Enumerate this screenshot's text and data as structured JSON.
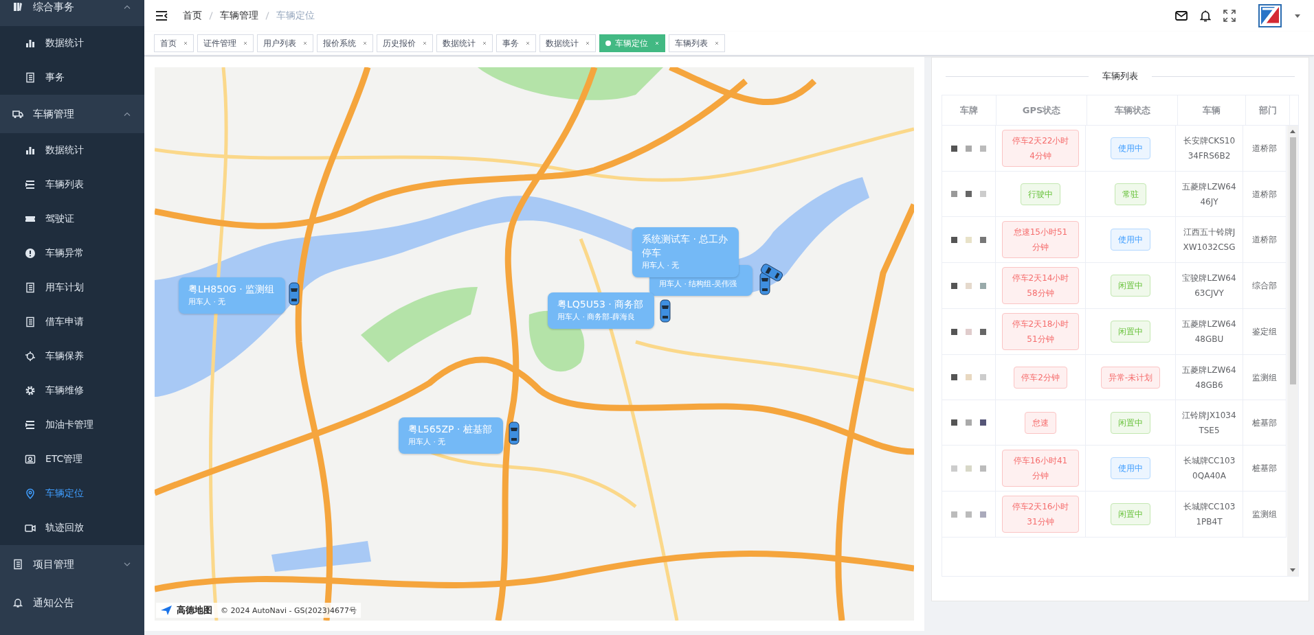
{
  "sidebar": {
    "groups": [
      {
        "label": "综合事务",
        "expanded": true,
        "items": [
          {
            "label": "数据统计",
            "selected": false
          },
          {
            "label": "事务",
            "selected": false
          }
        ]
      },
      {
        "label": "车辆管理",
        "expanded": true,
        "items": [
          {
            "label": "数据统计",
            "selected": false
          },
          {
            "label": "车辆列表",
            "selected": false
          },
          {
            "label": "驾驶证",
            "selected": false
          },
          {
            "label": "车辆异常",
            "selected": false
          },
          {
            "label": "用车计划",
            "selected": false
          },
          {
            "label": "借车申请",
            "selected": false
          },
          {
            "label": "车辆保养",
            "selected": false
          },
          {
            "label": "车辆维修",
            "selected": false
          },
          {
            "label": "加油卡管理",
            "selected": false
          },
          {
            "label": "ETC管理",
            "selected": false
          },
          {
            "label": "车辆定位",
            "selected": true
          },
          {
            "label": "轨迹回放",
            "selected": false
          }
        ]
      },
      {
        "label": "项目管理",
        "expanded": false
      },
      {
        "label": "通知公告"
      }
    ]
  },
  "breadcrumb": [
    "首页",
    "车辆管理",
    "车辆定位"
  ],
  "tabs": [
    {
      "label": "首页",
      "selected": false
    },
    {
      "label": "证件管理",
      "selected": false
    },
    {
      "label": "用户列表",
      "selected": false
    },
    {
      "label": "报价系统",
      "selected": false
    },
    {
      "label": "历史报价",
      "selected": false
    },
    {
      "label": "数据统计",
      "selected": false
    },
    {
      "label": "事务",
      "selected": false
    },
    {
      "label": "数据统计",
      "selected": false
    },
    {
      "label": "车辆定位",
      "selected": true
    },
    {
      "label": "车辆列表",
      "selected": false
    }
  ],
  "map": {
    "markers": [
      {
        "title": "粤LH850G · 监测组",
        "user": "用车人 · 无"
      },
      {
        "title": "粤LQ5U53 · 商务部",
        "user": "用车人 · 商务部-薛海良"
      },
      {
        "title": "粤L565ZP · 桩基部",
        "user": "用车人 · 无"
      },
      {
        "title": "系统测试车 · 总工办",
        "status": "停车",
        "user": "用车人 · 无"
      },
      {
        "user": "用车人 · 结构组-吴伟强"
      }
    ],
    "logo_text": "高德地图",
    "attribution": "© 2024 AutoNavi - GS(2023)4677号"
  },
  "vehicle_list": {
    "title": "车辆列表",
    "columns": [
      "车牌",
      "GPS状态",
      "车辆状态",
      "车辆",
      "部门"
    ],
    "rows": [
      {
        "gps": {
          "text": "停车2天22小时4分钟",
          "kind": "danger"
        },
        "status": {
          "text": "使用中",
          "kind": "primary"
        },
        "vehicle": "长安牌CKS1034FRS6B2",
        "dept": "道桥部"
      },
      {
        "gps": {
          "text": "行驶中",
          "kind": "success"
        },
        "status": {
          "text": "常驻",
          "kind": "success"
        },
        "vehicle": "五菱牌LZW6446JY",
        "dept": "道桥部"
      },
      {
        "gps": {
          "text": "怠速15小时51分钟",
          "kind": "danger"
        },
        "status": {
          "text": "使用中",
          "kind": "primary"
        },
        "vehicle": "江西五十铃牌JXW1032CSG",
        "dept": "道桥部"
      },
      {
        "gps": {
          "text": "停车2天14小时58分钟",
          "kind": "danger"
        },
        "status": {
          "text": "闲置中",
          "kind": "success"
        },
        "vehicle": "宝骏牌LZW6463CJVY",
        "dept": "综合部"
      },
      {
        "gps": {
          "text": "停车2天18小时51分钟",
          "kind": "danger"
        },
        "status": {
          "text": "闲置中",
          "kind": "success"
        },
        "vehicle": "五菱牌LZW6448GBU",
        "dept": "鉴定组"
      },
      {
        "gps": {
          "text": "停车2分钟",
          "kind": "danger"
        },
        "status": {
          "text": "异常-未计划",
          "kind": "danger"
        },
        "vehicle": "五菱牌LZW6448GB6",
        "dept": "监测组"
      },
      {
        "gps": {
          "text": "怠速",
          "kind": "danger"
        },
        "status": {
          "text": "闲置中",
          "kind": "success"
        },
        "vehicle": "江铃牌JX1034TSE5",
        "dept": "桩基部"
      },
      {
        "gps": {
          "text": "停车16小时41分钟",
          "kind": "danger"
        },
        "status": {
          "text": "使用中",
          "kind": "primary"
        },
        "vehicle": "长城牌CC1030QA40A",
        "dept": "桩基部"
      },
      {
        "gps": {
          "text": "停车2天16小时31分钟",
          "kind": "danger"
        },
        "status": {
          "text": "闲置中",
          "kind": "success"
        },
        "vehicle": "长城牌CC1031PB4T",
        "dept": "监测组"
      }
    ]
  }
}
